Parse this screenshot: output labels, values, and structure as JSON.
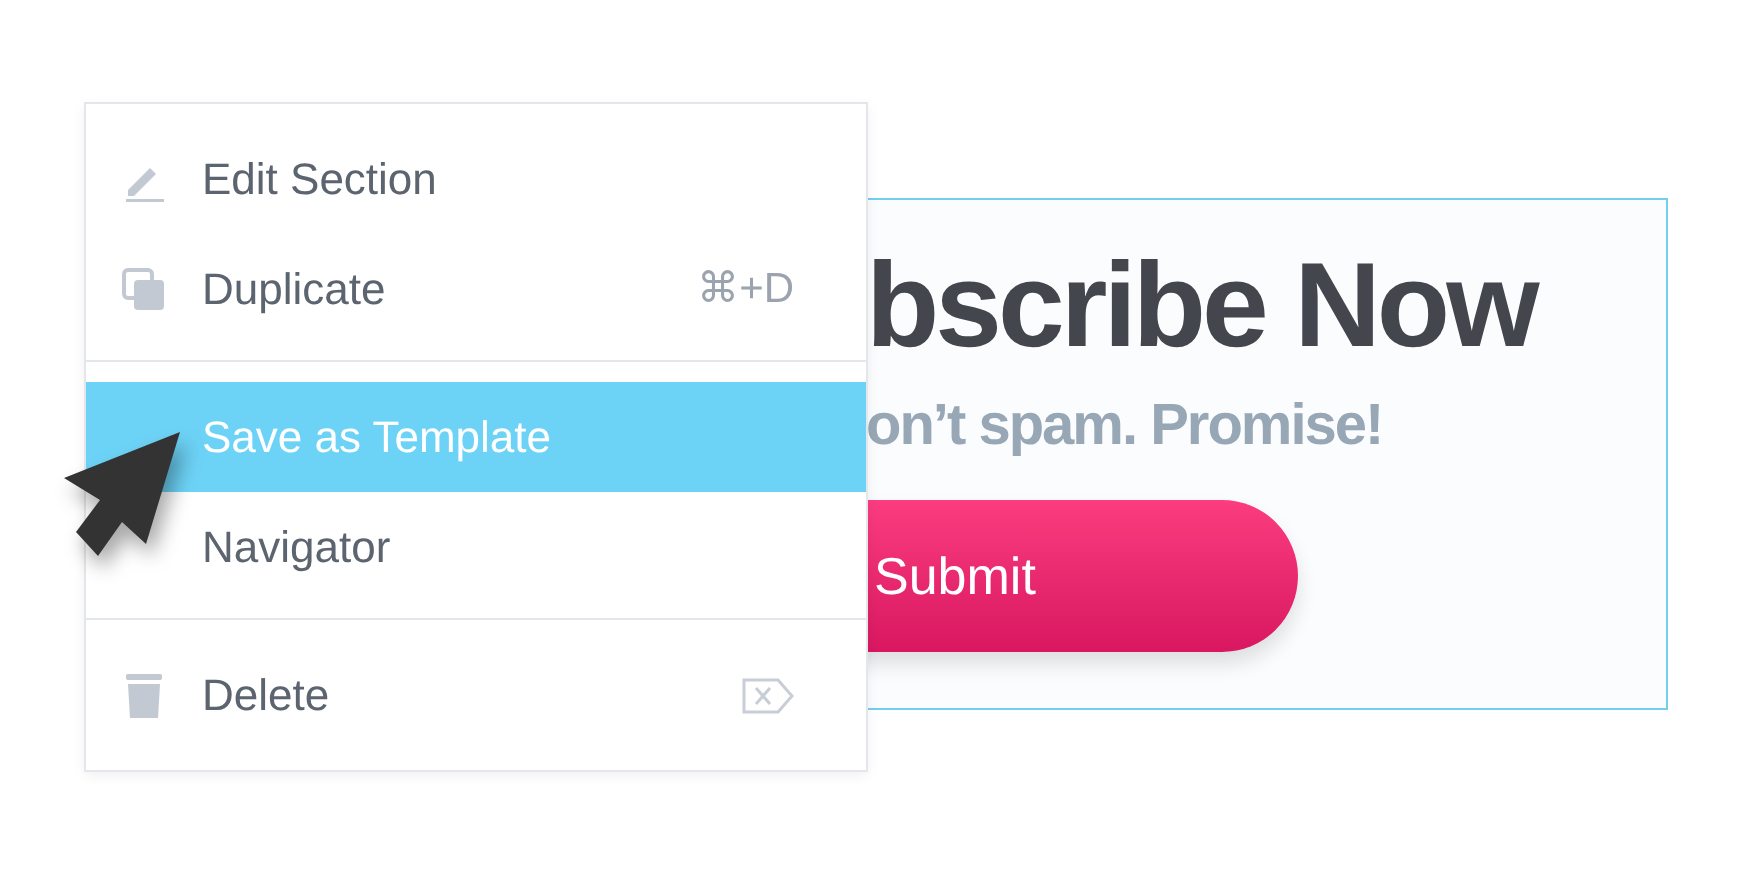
{
  "card": {
    "heading": "bscribe Now",
    "subheading": "on’t spam. Promise!",
    "button": "Submit"
  },
  "context_menu": {
    "sections": [
      {
        "items": [
          {
            "label": "Edit Section",
            "kind": "edit",
            "selected": false
          },
          {
            "label": "Duplicate",
            "kind": "duplicate",
            "shortcut": "⌘+D",
            "selected": false
          }
        ]
      },
      {
        "items": [
          {
            "label": "Save as Template",
            "kind": "plain",
            "selected": true
          },
          {
            "label": "Navigator",
            "kind": "plain",
            "selected": false
          }
        ]
      },
      {
        "items": [
          {
            "label": "Delete",
            "kind": "delete",
            "selected": false
          }
        ]
      }
    ]
  }
}
